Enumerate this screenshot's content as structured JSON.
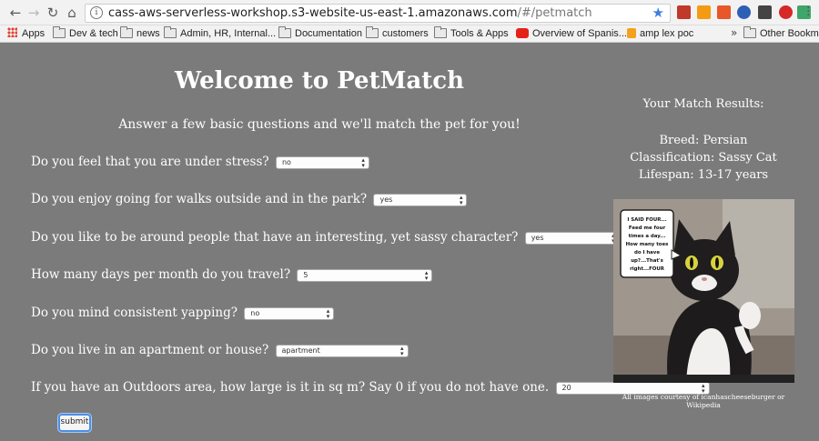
{
  "browser": {
    "url_main": "cass-aws-serverless-workshop.s3-website-us-east-1.amazonaws.com",
    "url_path": "/#/petmatch",
    "info_glyph": "i",
    "bookmarks": [
      {
        "label": "Apps",
        "icon": "apps-grid-icon"
      },
      {
        "label": "Dev & tech",
        "icon": "folder-icon"
      },
      {
        "label": "news",
        "icon": "folder-icon"
      },
      {
        "label": "Admin, HR, Internal...",
        "icon": "folder-icon"
      },
      {
        "label": "Documentation",
        "icon": "folder-icon"
      },
      {
        "label": "customers",
        "icon": "folder-icon"
      },
      {
        "label": "Tools & Apps",
        "icon": "folder-icon"
      },
      {
        "label": "Overview of Spanis...",
        "icon": "youtube-icon"
      },
      {
        "label": "amp lex poc",
        "icon": "amp-icon"
      }
    ],
    "more_label": "»",
    "other_bookmarks": "Other Bookmarks"
  },
  "page": {
    "title": "Welcome to PetMatch",
    "subtitle": "Answer a few basic questions and we'll match the pet for you!",
    "questions": [
      {
        "label": "Do you feel that you are under stress?",
        "value": "no"
      },
      {
        "label": "Do you enjoy going for walks outside and in the park?",
        "value": "yes"
      },
      {
        "label": "Do you like to be around people that have an interesting, yet sassy character?",
        "value": "yes"
      },
      {
        "label": "How many days per month do you travel?",
        "value": "5"
      },
      {
        "label": "Do you mind consistent yapping?",
        "value": "no"
      },
      {
        "label": "Do you live in an apartment or house?",
        "value": "apartment"
      },
      {
        "label": "If you have an Outdoors area, how large is it in sq m? Say 0 if you do not have one.",
        "value": "20"
      }
    ],
    "submit_label": "submit"
  },
  "results": {
    "heading": "Your Match Results:",
    "breed": "Breed: Persian",
    "classification": "Classification: Sassy Cat",
    "lifespan": "Lifespan: 13-17 years",
    "meme_text": [
      "I SAID FOUR...",
      "Feed me four",
      "times a day...",
      "How many toes",
      "do I have",
      "up?...That's",
      "right...FOUR"
    ],
    "credit": "All images courtesy of icanhascheeseburger or Wikipedia"
  },
  "colors": {
    "page_bg": "#7b7b7b",
    "link_blue": "#4c8ee6"
  }
}
